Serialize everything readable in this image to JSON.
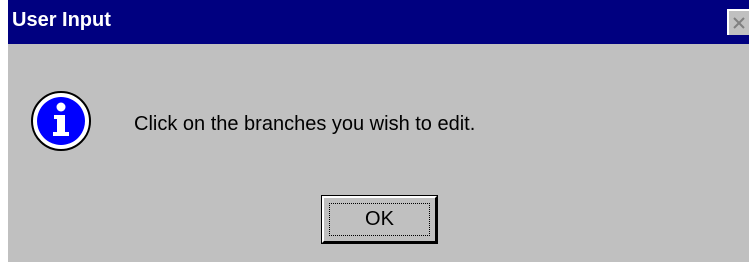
{
  "window": {
    "title": "User Input",
    "close_icon": "close-icon"
  },
  "content": {
    "icon": "info-icon",
    "icon_glyph": "i",
    "message": "Click on the branches you wish to edit."
  },
  "buttons": {
    "ok_label": "OK"
  },
  "colors": {
    "titlebar": "#000080",
    "dialog_bg": "#c0c0c0",
    "icon_fill": "#0000ff"
  }
}
